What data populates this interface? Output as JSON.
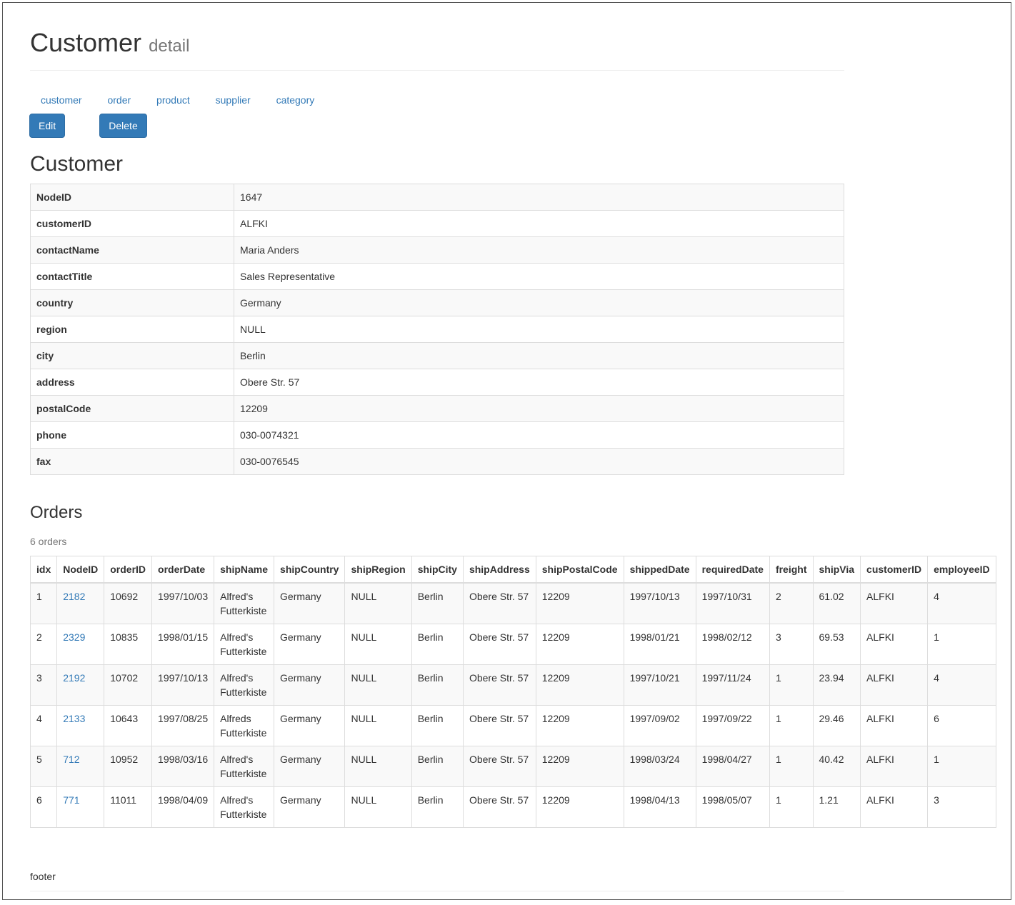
{
  "header": {
    "title": "Customer",
    "subtitle": "detail"
  },
  "nav": [
    "customer",
    "order",
    "product",
    "supplier",
    "category"
  ],
  "buttons": {
    "edit": "Edit",
    "delete": "Delete"
  },
  "customer_section_title": "Customer",
  "customer": [
    {
      "key": "NodeID",
      "value": "1647"
    },
    {
      "key": "customerID",
      "value": "ALFKI"
    },
    {
      "key": "contactName",
      "value": "Maria Anders"
    },
    {
      "key": "contactTitle",
      "value": "Sales Representative"
    },
    {
      "key": "country",
      "value": "Germany"
    },
    {
      "key": "region",
      "value": "NULL"
    },
    {
      "key": "city",
      "value": "Berlin"
    },
    {
      "key": "address",
      "value": "Obere Str. 57"
    },
    {
      "key": "postalCode",
      "value": "12209"
    },
    {
      "key": "phone",
      "value": "030-0074321"
    },
    {
      "key": "fax",
      "value": "030-0076545"
    }
  ],
  "orders_section_title": "Orders",
  "orders_count": "6 orders",
  "orders_columns": [
    "idx",
    "NodeID",
    "orderID",
    "orderDate",
    "shipName",
    "shipCountry",
    "shipRegion",
    "shipCity",
    "shipAddress",
    "shipPostalCode",
    "shippedDate",
    "requiredDate",
    "freight",
    "shipVia",
    "customerID",
    "employeeID"
  ],
  "orders": [
    [
      "1",
      "2182",
      "10692",
      "1997/10/03",
      "Alfred's\nFutterkiste",
      "Germany",
      "NULL",
      "Berlin",
      "Obere Str. 57",
      "12209",
      "1997/10/13",
      "1997/10/31",
      "2",
      "61.02",
      "ALFKI",
      "4"
    ],
    [
      "2",
      "2329",
      "10835",
      "1998/01/15",
      "Alfred's\nFutterkiste",
      "Germany",
      "NULL",
      "Berlin",
      "Obere Str. 57",
      "12209",
      "1998/01/21",
      "1998/02/12",
      "3",
      "69.53",
      "ALFKI",
      "1"
    ],
    [
      "3",
      "2192",
      "10702",
      "1997/10/13",
      "Alfred's\nFutterkiste",
      "Germany",
      "NULL",
      "Berlin",
      "Obere Str. 57",
      "12209",
      "1997/10/21",
      "1997/11/24",
      "1",
      "23.94",
      "ALFKI",
      "4"
    ],
    [
      "4",
      "2133",
      "10643",
      "1997/08/25",
      "Alfreds\nFutterkiste",
      "Germany",
      "NULL",
      "Berlin",
      "Obere Str. 57",
      "12209",
      "1997/09/02",
      "1997/09/22",
      "1",
      "29.46",
      "ALFKI",
      "6"
    ],
    [
      "5",
      "712",
      "10952",
      "1998/03/16",
      "Alfred's\nFutterkiste",
      "Germany",
      "NULL",
      "Berlin",
      "Obere Str. 57",
      "12209",
      "1998/03/24",
      "1998/04/27",
      "1",
      "40.42",
      "ALFKI",
      "1"
    ],
    [
      "6",
      "771",
      "11011",
      "1998/04/09",
      "Alfred's\nFutterkiste",
      "Germany",
      "NULL",
      "Berlin",
      "Obere Str. 57",
      "12209",
      "1998/04/13",
      "1998/05/07",
      "1",
      "1.21",
      "ALFKI",
      "3"
    ]
  ],
  "footer": "footer"
}
